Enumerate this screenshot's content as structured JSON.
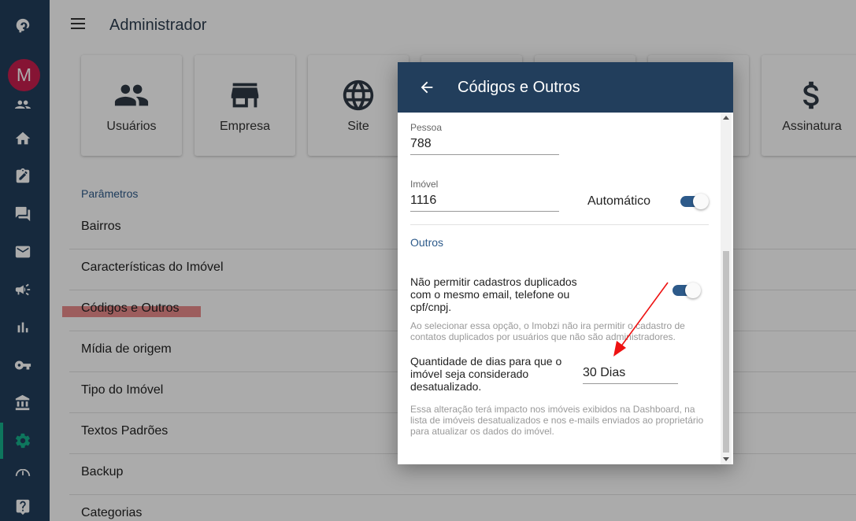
{
  "sidebar": {
    "avatar_letter": "M",
    "accent_color": "#16b18b",
    "icons": [
      "elephant-logo-icon",
      "users-icon",
      "home-icon",
      "clipboard-edit-icon",
      "forum-icon",
      "mail-icon",
      "megaphone-icon",
      "bar-chart-icon",
      "key-icon",
      "bank-icon",
      "gear-icon",
      "gauge-icon",
      "help-icon"
    ]
  },
  "header": {
    "title": "Administrador"
  },
  "cards": [
    {
      "label": "Usuários",
      "icon": "people-icon"
    },
    {
      "label": "Empresa",
      "icon": "store-icon"
    },
    {
      "label": "Site",
      "icon": "globe-icon"
    },
    {
      "label": "Assinatura",
      "icon": "dollar-icon"
    }
  ],
  "params": {
    "section_label": "Parâmetros",
    "items": [
      "Bairros",
      "Características do Imóvel",
      "Códigos e Outros",
      "Mídia de origem",
      "Tipo do Imóvel",
      "Textos Padrões",
      "Backup",
      "Categorias"
    ]
  },
  "modal": {
    "title": "Códigos e Outros",
    "pessoa_label": "Pessoa",
    "pessoa_value": "788",
    "imovel_label": "Imóvel",
    "imovel_value": "1116",
    "automatico_label": "Automático",
    "outros_label": "Outros",
    "duplicados_text": "Não permitir cadastros duplicados com o mesmo email, telefone ou cpf/cnpj.",
    "duplicados_hint": "Ao selecionar essa opção, o Imobzi não ira permitir o cadastro de contatos duplicados por usuários que não são administradores.",
    "dias_text": "Quantidade de dias para que o imóvel seja considerado desatualizado.",
    "dias_value": "30 Dias",
    "dias_hint": "Essa alteração terá impacto nos imóveis exibidos na Dashboard, na lista de imóveis desatualizados e nos e-mails enviados ao proprietário para atualizar os dados do imóvel.",
    "automatico_on": true,
    "duplicados_on": true
  }
}
